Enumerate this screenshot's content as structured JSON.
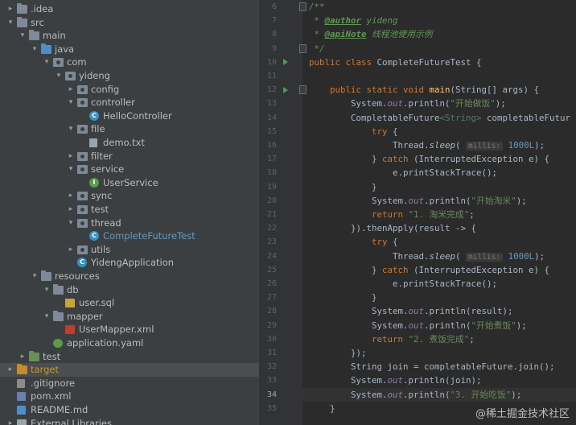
{
  "project_tree": [
    {
      "label": ".idea",
      "indent": 0,
      "expanded": false,
      "icon": "folder-icon",
      "style": "idea"
    },
    {
      "label": "src",
      "indent": 0,
      "expanded": true,
      "icon": "folder-icon",
      "style": ""
    },
    {
      "label": "main",
      "indent": 1,
      "expanded": true,
      "icon": "folder-icon",
      "style": ""
    },
    {
      "label": "java",
      "indent": 2,
      "expanded": true,
      "icon": "source-folder-icon",
      "style": ""
    },
    {
      "label": "com",
      "indent": 3,
      "expanded": true,
      "icon": "package-icon",
      "style": ""
    },
    {
      "label": "yideng",
      "indent": 4,
      "expanded": true,
      "icon": "package-icon",
      "style": ""
    },
    {
      "label": "config",
      "indent": 5,
      "expanded": false,
      "icon": "package-icon",
      "style": ""
    },
    {
      "label": "controller",
      "indent": 5,
      "expanded": true,
      "icon": "package-icon",
      "style": ""
    },
    {
      "label": "HelloController",
      "indent": 6,
      "expanded": null,
      "icon": "class-icon",
      "style": ""
    },
    {
      "label": "file",
      "indent": 5,
      "expanded": true,
      "icon": "package-icon",
      "style": ""
    },
    {
      "label": "demo.txt",
      "indent": 6,
      "expanded": null,
      "icon": "text-file-icon",
      "style": ""
    },
    {
      "label": "filter",
      "indent": 5,
      "expanded": false,
      "icon": "package-icon",
      "style": ""
    },
    {
      "label": "service",
      "indent": 5,
      "expanded": true,
      "icon": "package-icon",
      "style": ""
    },
    {
      "label": "UserService",
      "indent": 6,
      "expanded": null,
      "icon": "interface-icon",
      "style": ""
    },
    {
      "label": "sync",
      "indent": 5,
      "expanded": false,
      "icon": "package-icon",
      "style": ""
    },
    {
      "label": "test",
      "indent": 5,
      "expanded": false,
      "icon": "package-icon",
      "style": ""
    },
    {
      "label": "thread",
      "indent": 5,
      "expanded": true,
      "icon": "package-icon",
      "style": ""
    },
    {
      "label": "CompleteFutureTest",
      "indent": 6,
      "expanded": null,
      "icon": "class-icon",
      "style": "active"
    },
    {
      "label": "utils",
      "indent": 5,
      "expanded": false,
      "icon": "package-icon",
      "style": ""
    },
    {
      "label": "YidengApplication",
      "indent": 5,
      "expanded": null,
      "icon": "spring-class-icon",
      "style": ""
    },
    {
      "label": "resources",
      "indent": 2,
      "expanded": true,
      "icon": "resources-folder-icon",
      "style": ""
    },
    {
      "label": "db",
      "indent": 3,
      "expanded": true,
      "icon": "folder-icon",
      "style": ""
    },
    {
      "label": "user.sql",
      "indent": 4,
      "expanded": null,
      "icon": "sql-file-icon",
      "style": ""
    },
    {
      "label": "mapper",
      "indent": 3,
      "expanded": true,
      "icon": "folder-icon",
      "style": ""
    },
    {
      "label": "UserMapper.xml",
      "indent": 4,
      "expanded": null,
      "icon": "xml-file-icon",
      "style": ""
    },
    {
      "label": "application.yaml",
      "indent": 3,
      "expanded": null,
      "icon": "yaml-file-icon",
      "style": ""
    },
    {
      "label": "test",
      "indent": 1,
      "expanded": false,
      "icon": "test-folder-icon",
      "style": ""
    },
    {
      "label": "target",
      "indent": 0,
      "expanded": false,
      "icon": "excluded-folder-icon",
      "style": "target"
    },
    {
      "label": ".gitignore",
      "indent": 0,
      "expanded": null,
      "icon": "gitignore-file-icon",
      "style": ""
    },
    {
      "label": "pom.xml",
      "indent": 0,
      "expanded": null,
      "icon": "maven-file-icon",
      "style": ""
    },
    {
      "label": "README.md",
      "indent": 0,
      "expanded": null,
      "icon": "markdown-file-icon",
      "style": ""
    },
    {
      "label": "External Libraries",
      "indent": 0,
      "expanded": false,
      "icon": "libraries-icon",
      "style": ""
    }
  ],
  "editor": {
    "current_line": 34,
    "lines": [
      {
        "n": "6",
        "run": false,
        "bookmark": true,
        "tokens": [
          [
            "cmt",
            "/**"
          ]
        ]
      },
      {
        "n": "7",
        "run": false,
        "bookmark": false,
        "tokens": [
          [
            "cmt",
            " * "
          ],
          [
            "tag",
            "@author"
          ],
          [
            "cmt",
            " yideng"
          ]
        ]
      },
      {
        "n": "8",
        "run": false,
        "bookmark": false,
        "tokens": [
          [
            "cmt",
            " * "
          ],
          [
            "tag",
            "@apiNote"
          ],
          [
            "cmt",
            " 线程池使用示例"
          ]
        ]
      },
      {
        "n": "9",
        "run": false,
        "bookmark": true,
        "tokens": [
          [
            "cmt",
            " */"
          ]
        ]
      },
      {
        "n": "10",
        "run": true,
        "bookmark": false,
        "tokens": [
          [
            "kw",
            "public class "
          ],
          [
            "",
            "CompleteFutureTest {"
          ]
        ]
      },
      {
        "n": "11",
        "run": false,
        "bookmark": false,
        "tokens": []
      },
      {
        "n": "12",
        "run": true,
        "bookmark": true,
        "tokens": [
          [
            "",
            "    "
          ],
          [
            "kw",
            "public static void "
          ],
          [
            "mth",
            "main"
          ],
          [
            "",
            "(String[] args) {"
          ]
        ]
      },
      {
        "n": "13",
        "run": false,
        "bookmark": false,
        "tokens": [
          [
            "",
            "        System."
          ],
          [
            "fld",
            "out"
          ],
          [
            "",
            ".println("
          ],
          [
            "str",
            "\"开始做饭\""
          ],
          [
            "",
            ");"
          ]
        ]
      },
      {
        "n": "14",
        "run": false,
        "bookmark": false,
        "tokens": [
          [
            "",
            "        CompletableFuture"
          ],
          [
            "gen",
            "<String>"
          ],
          [
            "",
            " completableFutur"
          ]
        ]
      },
      {
        "n": "15",
        "run": false,
        "bookmark": false,
        "tokens": [
          [
            "",
            "            "
          ],
          [
            "kw",
            "try "
          ],
          [
            "",
            "{"
          ]
        ]
      },
      {
        "n": "16",
        "run": false,
        "bookmark": false,
        "tokens": [
          [
            "",
            "                Thread."
          ],
          [
            "ital",
            "sleep"
          ],
          [
            "",
            "( "
          ],
          [
            "hint",
            "millis:"
          ],
          [
            "",
            " "
          ],
          [
            "num",
            "1000L"
          ],
          [
            "",
            ");"
          ]
        ]
      },
      {
        "n": "17",
        "run": false,
        "bookmark": false,
        "tokens": [
          [
            "",
            "            } "
          ],
          [
            "kw",
            "catch "
          ],
          [
            "",
            "(InterruptedException e) {"
          ]
        ]
      },
      {
        "n": "18",
        "run": false,
        "bookmark": false,
        "tokens": [
          [
            "",
            "                e.printStackTrace();"
          ]
        ]
      },
      {
        "n": "19",
        "run": false,
        "bookmark": false,
        "tokens": [
          [
            "",
            "            }"
          ]
        ]
      },
      {
        "n": "20",
        "run": false,
        "bookmark": false,
        "tokens": [
          [
            "",
            "            System."
          ],
          [
            "fld",
            "out"
          ],
          [
            "",
            ".println("
          ],
          [
            "str",
            "\"开始淘米\""
          ],
          [
            "",
            ");"
          ]
        ]
      },
      {
        "n": "21",
        "run": false,
        "bookmark": false,
        "tokens": [
          [
            "",
            "            "
          ],
          [
            "kw",
            "return "
          ],
          [
            "str",
            "\"1. 淘米完成\""
          ],
          [
            "",
            ";"
          ]
        ]
      },
      {
        "n": "22",
        "run": false,
        "bookmark": false,
        "tokens": [
          [
            "",
            "        }).thenApply(result -> {"
          ]
        ]
      },
      {
        "n": "23",
        "run": false,
        "bookmark": false,
        "tokens": [
          [
            "",
            "            "
          ],
          [
            "kw",
            "try "
          ],
          [
            "",
            "{"
          ]
        ]
      },
      {
        "n": "24",
        "run": false,
        "bookmark": false,
        "tokens": [
          [
            "",
            "                Thread."
          ],
          [
            "ital",
            "sleep"
          ],
          [
            "",
            "( "
          ],
          [
            "hint",
            "millis:"
          ],
          [
            "",
            " "
          ],
          [
            "num",
            "1000L"
          ],
          [
            "",
            ");"
          ]
        ]
      },
      {
        "n": "25",
        "run": false,
        "bookmark": false,
        "tokens": [
          [
            "",
            "            } "
          ],
          [
            "kw",
            "catch "
          ],
          [
            "",
            "(InterruptedException e) {"
          ]
        ]
      },
      {
        "n": "26",
        "run": false,
        "bookmark": false,
        "tokens": [
          [
            "",
            "                e.printStackTrace();"
          ]
        ]
      },
      {
        "n": "27",
        "run": false,
        "bookmark": false,
        "tokens": [
          [
            "",
            "            }"
          ]
        ]
      },
      {
        "n": "28",
        "run": false,
        "bookmark": false,
        "tokens": [
          [
            "",
            "            System."
          ],
          [
            "fld",
            "out"
          ],
          [
            "",
            ".println(result);"
          ]
        ]
      },
      {
        "n": "29",
        "run": false,
        "bookmark": false,
        "tokens": [
          [
            "",
            "            System."
          ],
          [
            "fld",
            "out"
          ],
          [
            "",
            ".println("
          ],
          [
            "str",
            "\"开始煮饭\""
          ],
          [
            "",
            ");"
          ]
        ]
      },
      {
        "n": "30",
        "run": false,
        "bookmark": false,
        "tokens": [
          [
            "",
            "            "
          ],
          [
            "kw",
            "return "
          ],
          [
            "str",
            "\"2. 煮饭完成\""
          ],
          [
            "",
            ";"
          ]
        ]
      },
      {
        "n": "31",
        "run": false,
        "bookmark": false,
        "tokens": [
          [
            "",
            "        });"
          ]
        ]
      },
      {
        "n": "32",
        "run": false,
        "bookmark": false,
        "tokens": [
          [
            "",
            "        String join = completableFuture.join();"
          ]
        ]
      },
      {
        "n": "33",
        "run": false,
        "bookmark": false,
        "tokens": [
          [
            "",
            "        System."
          ],
          [
            "fld",
            "out"
          ],
          [
            "",
            ".println(join);"
          ]
        ]
      },
      {
        "n": "34",
        "run": false,
        "bookmark": false,
        "tokens": [
          [
            "",
            "        System."
          ],
          [
            "fld",
            "out"
          ],
          [
            "",
            ".println("
          ],
          [
            "str",
            "\"3. 开始吃饭\""
          ],
          [
            "",
            ");"
          ]
        ]
      },
      {
        "n": "35",
        "run": false,
        "bookmark": false,
        "tokens": [
          [
            "",
            "    }"
          ]
        ]
      }
    ]
  },
  "watermark": "@稀土掘金技术社区",
  "colors": {
    "tree_bg": "#3c3f41",
    "editor_bg": "#2b2b2b",
    "keyword": "#cc7832",
    "string": "#6a8759",
    "number": "#6897bb",
    "comment": "#629755",
    "field": "#9876aa",
    "method": "#ffc66d",
    "target": "#c99734"
  }
}
